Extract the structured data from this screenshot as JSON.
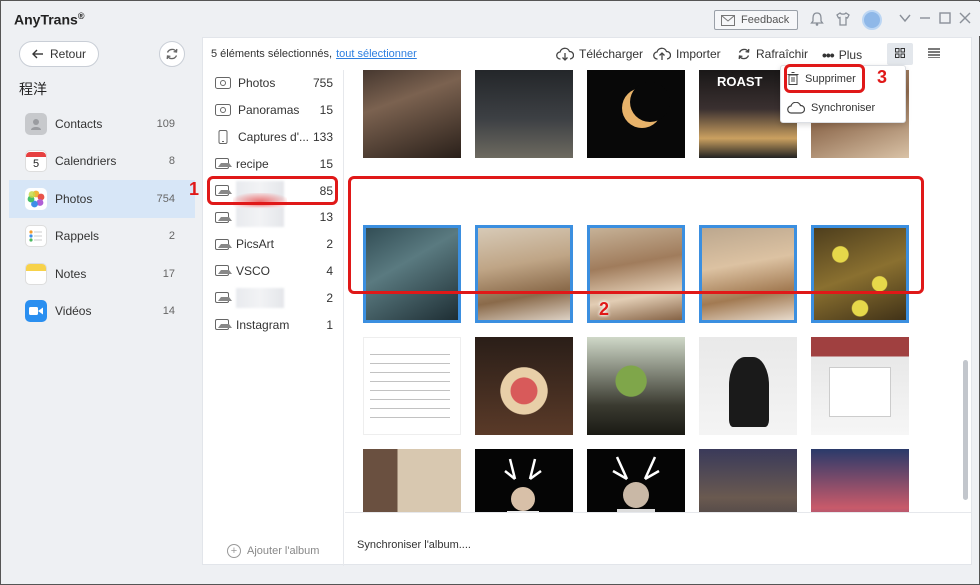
{
  "app": {
    "title": "AnyTrans",
    "reg": "®"
  },
  "titlebar": {
    "feedback_label": "Feedback"
  },
  "sidebar": {
    "back_label": "Retour",
    "device_name": "程洋",
    "categories": [
      {
        "label": "Contacts",
        "count": "109",
        "icon": "contacts-icon",
        "color": "#c7c9cc"
      },
      {
        "label": "Calendriers",
        "count": "8",
        "icon": "calendar-icon",
        "color": "#ffffff"
      },
      {
        "label": "Photos",
        "count": "754",
        "icon": "photos-icon",
        "color": "#f2a23a"
      },
      {
        "label": "Rappels",
        "count": "2",
        "icon": "reminders-icon",
        "color": "#ffffff"
      },
      {
        "label": "Notes",
        "count": "17",
        "icon": "notes-icon",
        "color": "#f7d24a"
      },
      {
        "label": "Vidéos",
        "count": "14",
        "icon": "videos-icon",
        "color": "#2a8ff0"
      }
    ],
    "calendar_day": "5"
  },
  "toolbar": {
    "selection_text": "5 éléments sélectionnés,",
    "select_all": "tout sélectionner",
    "download": "Télécharger",
    "import": "Importer",
    "refresh": "Rafraîchir",
    "more": "Plus"
  },
  "albums": [
    {
      "label": "Photos",
      "count": "755",
      "icon": "panorama-icon"
    },
    {
      "label": "Panoramas",
      "count": "15",
      "icon": "panorama-icon"
    },
    {
      "label": "Captures d'...",
      "count": "133",
      "icon": "phone-icon"
    },
    {
      "label": "recipe",
      "count": "15",
      "icon": "album-icon"
    },
    {
      "label": "",
      "count": "85",
      "icon": "album-icon"
    },
    {
      "label": "",
      "count": "13",
      "icon": "album-icon"
    },
    {
      "label": "PicsArt",
      "count": "2",
      "icon": "album-icon"
    },
    {
      "label": "VSCO",
      "count": "4",
      "icon": "album-icon"
    },
    {
      "label": "",
      "count": "2",
      "icon": "album-icon"
    },
    {
      "label": "Instagram",
      "count": "1",
      "icon": "album-icon"
    }
  ],
  "add_album": "Ajouter l'album",
  "footer": {
    "sync_text": "Synchroniser l'album...."
  },
  "dropdown": {
    "delete": "Supprimer",
    "sync": "Synchroniser"
  },
  "annotations": {
    "a1": "1",
    "a2": "2",
    "a3": "3"
  },
  "colors": {
    "accent": "#2d7fe0",
    "selection": "#3b8fe0",
    "annotation": "#e01818",
    "sidebar_active": "#d7e6f7"
  }
}
